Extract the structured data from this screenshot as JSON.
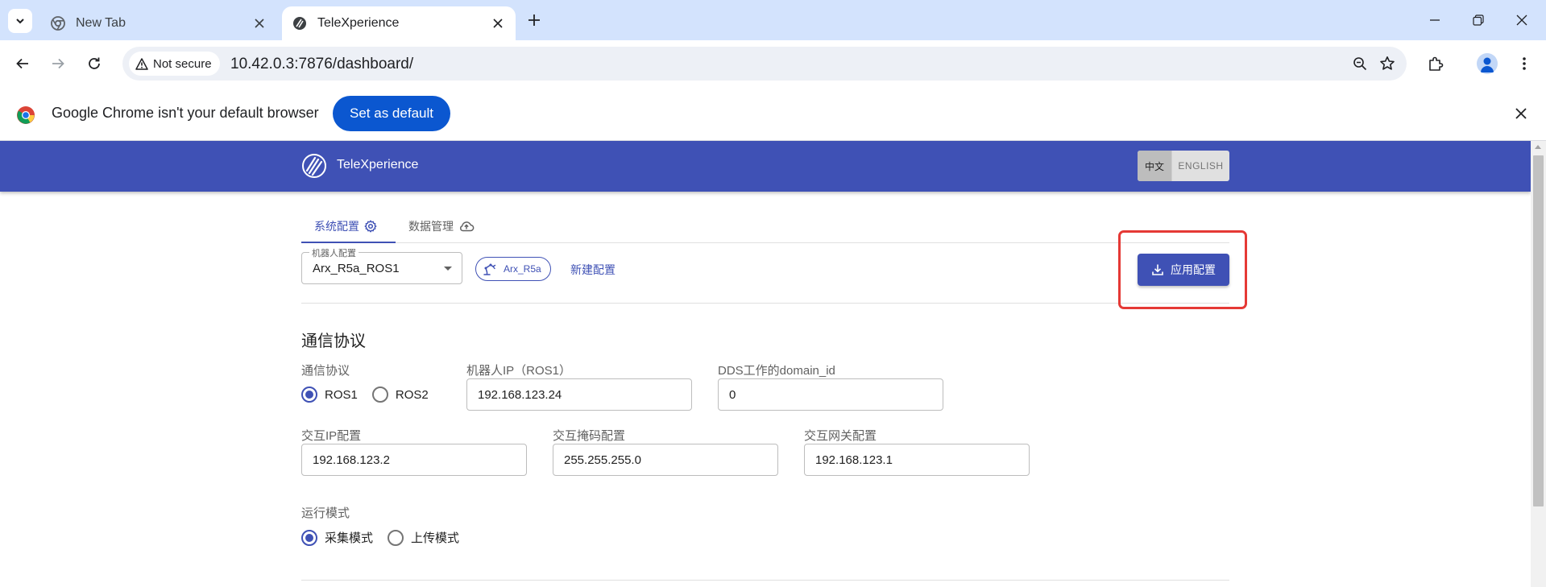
{
  "browser": {
    "tabs": [
      {
        "title": "New Tab",
        "icon": "chrome-icon",
        "active": false
      },
      {
        "title": "TeleXperience",
        "icon": "telexperience-favicon",
        "active": true
      }
    ],
    "security_label": "Not secure",
    "url": "10.42.0.3:7876/dashboard/"
  },
  "infobar": {
    "message": "Google Chrome isn't your default browser",
    "button_label": "Set as default"
  },
  "app": {
    "brand": "TeleXperience",
    "lang_zh": "中文",
    "lang_en": "ENGLISH",
    "accent_color": "#3f51b5"
  },
  "nav": {
    "tabs": [
      {
        "label": "系统配置",
        "icon": "gear-icon",
        "active": true
      },
      {
        "label": "数据管理",
        "icon": "cloud-upload-icon",
        "active": false
      }
    ]
  },
  "config": {
    "robot_config_label": "机器人配置",
    "robot_config_value": "Arx_R5a_ROS1",
    "robot_chip_label": "Arx_R5a",
    "new_config_label": "新建配置",
    "apply_label": "应用配置"
  },
  "comm": {
    "section_title": "通信协议",
    "protocol_label": "通信协议",
    "protocol_options": [
      "ROS1",
      "ROS2"
    ],
    "protocol_selected": "ROS1",
    "robot_ip_label": "机器人IP（ROS1）",
    "robot_ip_value": "192.168.123.24",
    "domain_id_label": "DDS工作的domain_id",
    "domain_id_value": "0",
    "interact_ip_label": "交互IP配置",
    "interact_ip_value": "192.168.123.2",
    "netmask_label": "交互掩码配置",
    "netmask_value": "255.255.255.0",
    "gateway_label": "交互网关配置",
    "gateway_value": "192.168.123.1"
  },
  "mode": {
    "label": "运行模式",
    "options": [
      "采集模式",
      "上传模式"
    ],
    "selected": "采集模式"
  }
}
